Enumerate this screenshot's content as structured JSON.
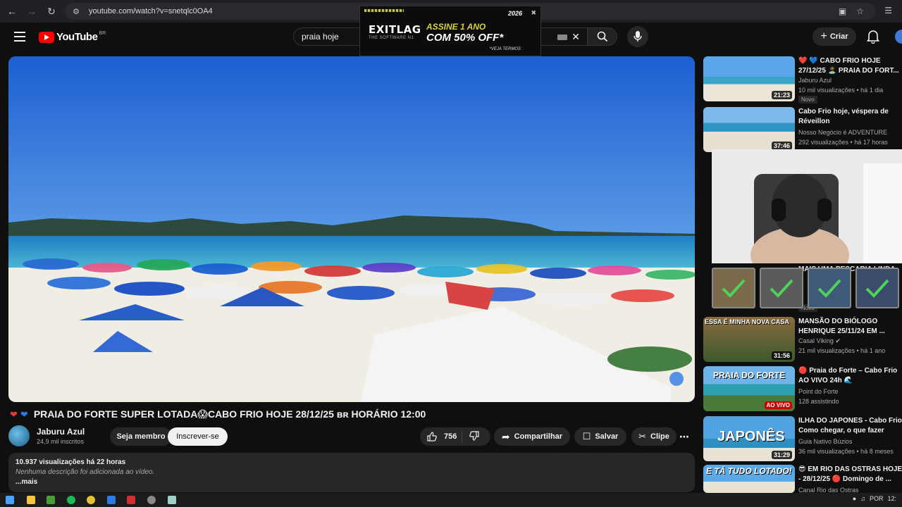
{
  "browser": {
    "url": "youtube.com/watch?v=snetqlc0OA4"
  },
  "ad": {
    "brand": "EXITLAG",
    "tagline": "THE SOFTWARE N1",
    "offer_line1": "ASSINE 1 ANO",
    "offer_line2": "COM 50% OFF*",
    "terms": "*VEJA TERMOS",
    "year": "2026"
  },
  "header": {
    "logo_text": "YouTube",
    "region": "BR",
    "search_value": "praia hoje",
    "create_label": "Criar"
  },
  "video": {
    "title": "PRAIA DO FORTE SUPER LOTADA😱CABO FRIO HOJE 28/12/25 ʙʀ HORÁRIO 12:00",
    "channel_name": "Jaburu Azul",
    "subscribers": "24,9 mil inscritos",
    "join_label": "Seja membro",
    "subscribe_label": "Inscrever-se",
    "likes": "756",
    "share_label": "Compartilhar",
    "save_label": "Salvar",
    "clip_label": "Clipe",
    "views_line": "10.937 visualizações  há 22 horas",
    "description": "Nenhuma descrição foi adicionada ao vídeo.",
    "more_label": "...mais"
  },
  "recommendations": [
    {
      "title": "❤️ 💙 CABO FRIO HOJE 27/12/25 🏝️ PRAIA DO FORT...",
      "channel": "Jaburu Azul",
      "views": "10 mil visualizações • há 1 dia",
      "badge": "Novo",
      "duration": "21:23"
    },
    {
      "title": "Cabo Frio hoje, véspera de Réveillon",
      "channel": "Nosso Negócio é ADVENTURE",
      "views": "292 visualizações • há 17 horas",
      "duration": "37:46"
    },
    {
      "title": "MAIS UMA PESCARIA LINDA",
      "channel": "",
      "views": "",
      "badge": "Novo"
    },
    {
      "title": "MANSÃO DO BIÓLOGO HENRIQUE 25/11/24 EM ...",
      "channel": "Casal Viking ✔",
      "views": "21 mil visualizações • há 1 ano",
      "duration": "31:56",
      "thumb_text": "ESSA É MINHA NOVA CASA"
    },
    {
      "title": "🔴 Praia do Forte – Cabo Frio AO VIVO 24h 🌊",
      "channel": "Point do Forte",
      "views": "128 assistindo",
      "live": "AO VIVO",
      "thumb_text": "PRAIA DO FORTE"
    },
    {
      "title": "ILHA DO JAPONES - Cabo Frio Como chegar, o que fazer",
      "channel": "Guia Nativo Búzios",
      "views": "36 mil visualizações • há 8 meses",
      "duration": "31:29",
      "thumb_text": "JAPONÊS"
    },
    {
      "title": "😎 EM RIO DAS OSTRAS HOJE - 28/12/25 🔴 Domingo de ...",
      "channel": "Canal Rio das Ostras",
      "views": "",
      "thumb_text": "E TÁ TUDO LOTADO!"
    }
  ],
  "taskbar": {
    "lang": "POR",
    "clock": "12:"
  },
  "colors": {
    "background": "#0f0f0f",
    "accent_red": "#ff0000",
    "pill": "#272727"
  }
}
